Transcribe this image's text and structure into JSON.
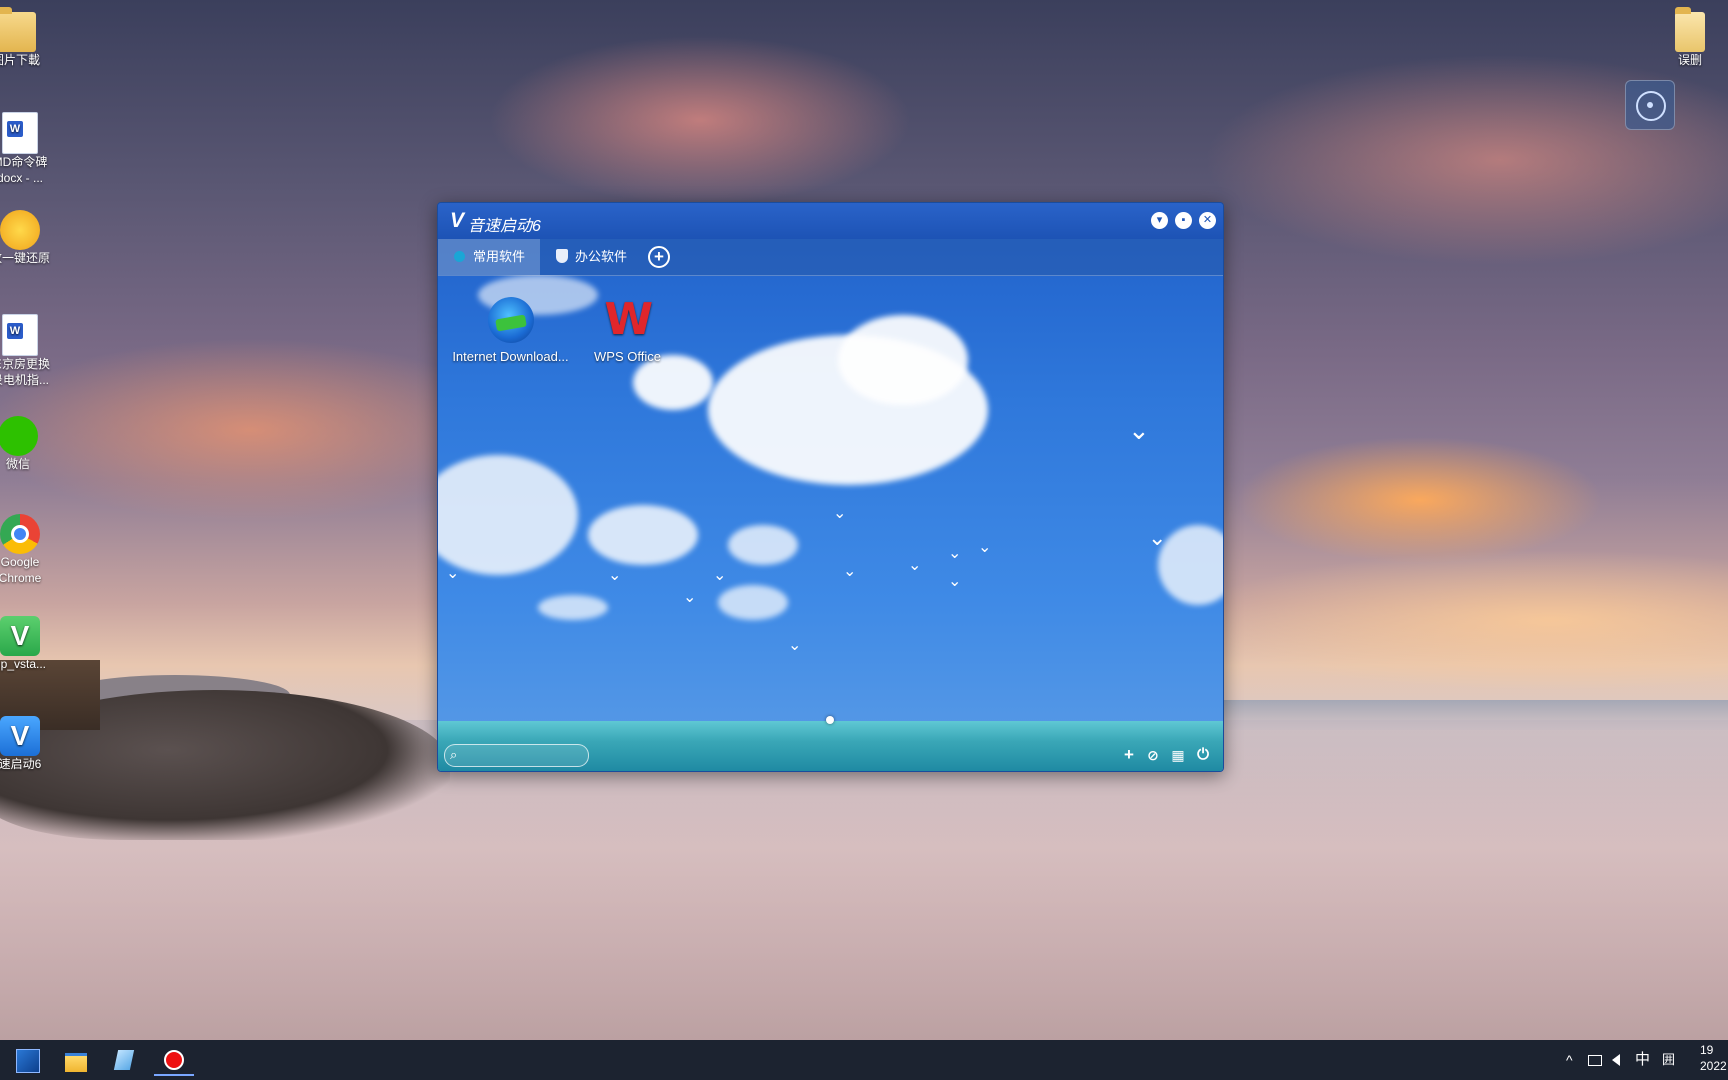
{
  "desktop": {
    "icons": [
      {
        "label": "图片下載"
      },
      {
        "label": "MD命令碑\ndocx - ..."
      },
      {
        "label": "数一键还原"
      },
      {
        "label": "东京房更换\n录电机指..."
      },
      {
        "label": "微信"
      },
      {
        "label": "Google\nChrome"
      },
      {
        "label": "up_vsta..."
      },
      {
        "label": "速启动6"
      },
      {
        "label": "误删"
      }
    ]
  },
  "app": {
    "logo": "V",
    "title": "音速启动6",
    "window_buttons": {
      "menu": "▾",
      "skin": "▪",
      "close": "✕"
    },
    "tabs": [
      {
        "label": "常用软件",
        "active": true
      },
      {
        "label": "办公软件",
        "active": false
      }
    ],
    "add_tab": "+",
    "apps": [
      {
        "label": "Internet Download...",
        "icon": "idm-icon"
      },
      {
        "label": "WPS Office",
        "icon": "wps-icon"
      }
    ],
    "wps_glyph": "W",
    "search": {
      "placeholder": "",
      "icon": "⌕"
    },
    "toolbar": {
      "add": "+",
      "tag": "⊘",
      "calendar": "▦",
      "power": "⏻"
    }
  },
  "taskbar": {
    "items": [
      "start",
      "file-explorer",
      "notepad",
      "recorder"
    ],
    "tray": {
      "chevron": "^",
      "ime": "中",
      "ime2": "囲",
      "time": "19",
      "date": "2022"
    }
  },
  "colors": {
    "accent": "#1d53b5",
    "taskbar": "#1c2330",
    "wps_red": "#e0262b"
  }
}
